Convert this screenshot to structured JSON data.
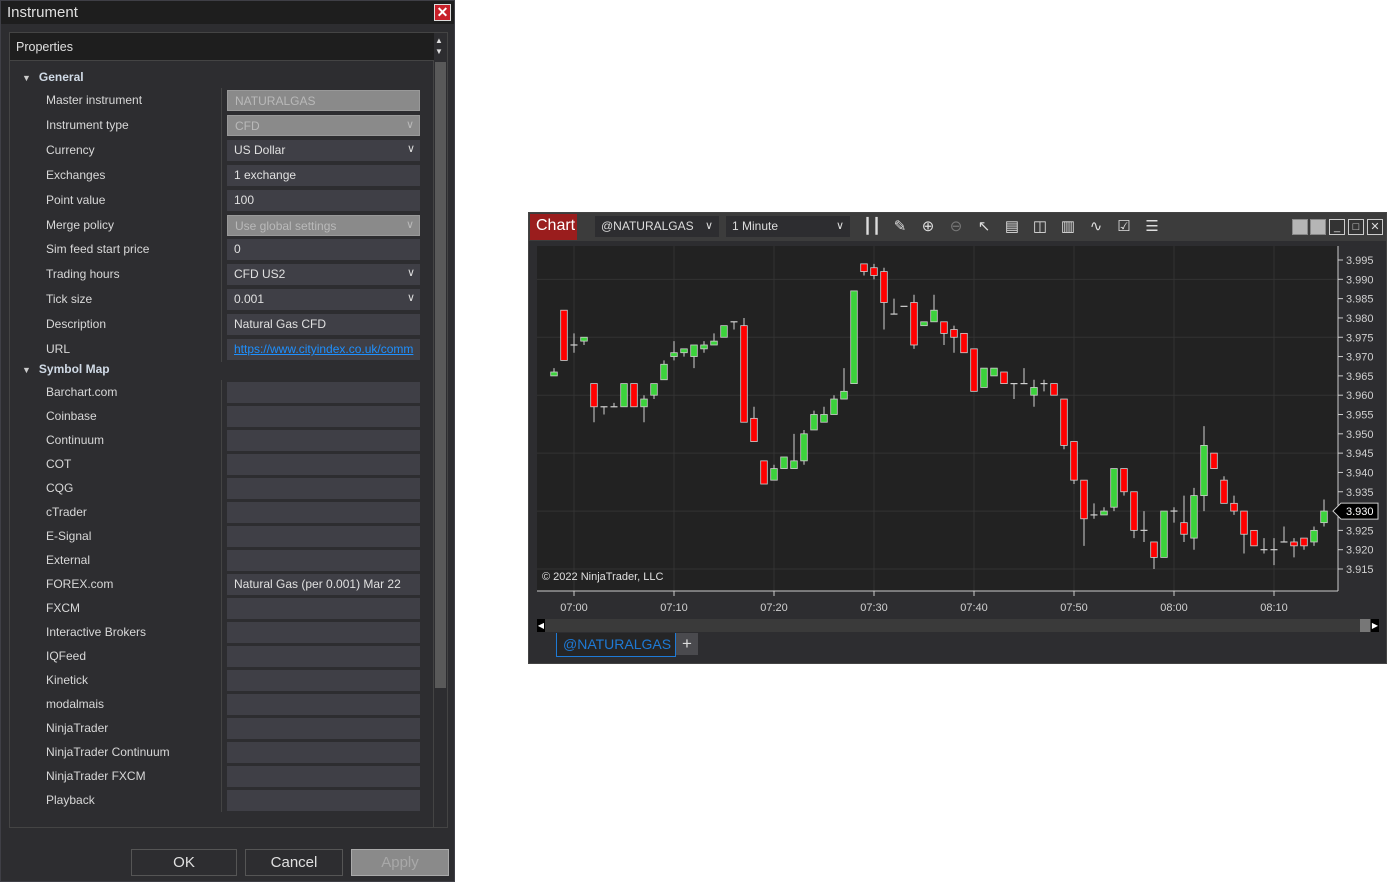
{
  "dialog": {
    "title": "Instrument",
    "properties_header": "Properties",
    "categories": [
      {
        "label": "General",
        "rows": [
          {
            "label": "Master instrument",
            "value": "NATURALGAS",
            "readonly": true,
            "dropdown": false
          },
          {
            "label": "Instrument type",
            "value": "CFD",
            "readonly": true,
            "dropdown": true
          },
          {
            "label": "Currency",
            "value": "US Dollar",
            "readonly": false,
            "dropdown": true
          },
          {
            "label": "Exchanges",
            "value": "1 exchange",
            "readonly": false,
            "dropdown": false
          },
          {
            "label": "Point value",
            "value": "100",
            "readonly": false,
            "dropdown": false
          },
          {
            "label": "Merge policy",
            "value": "Use global settings",
            "readonly": true,
            "dropdown": true
          },
          {
            "label": "Sim feed start price",
            "value": "0",
            "readonly": false,
            "dropdown": false
          },
          {
            "label": "Trading hours",
            "value": "CFD US2",
            "readonly": false,
            "dropdown": true
          },
          {
            "label": "Tick size",
            "value": "0.001",
            "readonly": false,
            "dropdown": true
          },
          {
            "label": "Description",
            "value": "Natural Gas CFD",
            "readonly": false,
            "dropdown": false
          },
          {
            "label": "URL",
            "value": "https://www.cityindex.co.uk/comm",
            "readonly": false,
            "dropdown": false,
            "link": true
          }
        ]
      },
      {
        "label": "Symbol Map",
        "rows": [
          {
            "label": "Barchart.com",
            "value": ""
          },
          {
            "label": "Coinbase",
            "value": ""
          },
          {
            "label": "Continuum",
            "value": ""
          },
          {
            "label": "COT",
            "value": ""
          },
          {
            "label": "CQG",
            "value": ""
          },
          {
            "label": "cTrader",
            "value": ""
          },
          {
            "label": "E-Signal",
            "value": ""
          },
          {
            "label": "External",
            "value": ""
          },
          {
            "label": "FOREX.com",
            "value": "Natural Gas (per 0.001) Mar 22"
          },
          {
            "label": "FXCM",
            "value": ""
          },
          {
            "label": "Interactive Brokers",
            "value": ""
          },
          {
            "label": "IQFeed",
            "value": ""
          },
          {
            "label": "Kinetick",
            "value": ""
          },
          {
            "label": "modalmais",
            "value": ""
          },
          {
            "label": "NinjaTrader",
            "value": ""
          },
          {
            "label": "NinjaTrader Continuum",
            "value": ""
          },
          {
            "label": "NinjaTrader FXCM",
            "value": ""
          },
          {
            "label": "Playback",
            "value": ""
          }
        ]
      }
    ],
    "buttons": {
      "ok": "OK",
      "cancel": "Cancel",
      "apply": "Apply"
    }
  },
  "chart_window": {
    "title": "Chart",
    "instrument": "@NATURALGAS",
    "interval": "1 Minute",
    "toolbar_icons": [
      "bar-type-icon",
      "drawing-tool-icon",
      "zoom-in-icon",
      "zoom-out-icon",
      "pointer-icon",
      "data-box-icon",
      "chart-trader-icon",
      "indicators-icon",
      "strategies-icon",
      "properties-icon",
      "templates-icon"
    ],
    "copyright": "© 2022 NinjaTrader, LLC",
    "tab": "@NATURALGAS",
    "tab_add": "+",
    "colors": {
      "up": "#3cd23c",
      "down": "#ff0000",
      "wick": "#d0d0d0",
      "background": "#222222",
      "accent": "#9a1d1d"
    }
  },
  "chart_data": {
    "type": "candlestick",
    "xlabel": "",
    "ylabel": "",
    "ylim": [
      3.912,
      3.998
    ],
    "yticks": [
      "3.995",
      "3.990",
      "3.985",
      "3.980",
      "3.975",
      "3.970",
      "3.965",
      "3.960",
      "3.955",
      "3.950",
      "3.945",
      "3.940",
      "3.935",
      "3.930",
      "3.925",
      "3.920",
      "3.915"
    ],
    "xticks": [
      "07:00",
      "07:10",
      "07:20",
      "07:30",
      "07:40",
      "07:50",
      "08:00",
      "08:10"
    ],
    "last_price": "3.930",
    "grid": true,
    "columns": [
      "time",
      "open",
      "high",
      "low",
      "close"
    ],
    "candles": [
      [
        "06:58",
        3.965,
        3.967,
        3.965,
        3.966
      ],
      [
        "06:59",
        3.982,
        3.982,
        3.969,
        3.969
      ],
      [
        "07:00",
        3.973,
        3.976,
        3.971,
        3.973
      ],
      [
        "07:01",
        3.974,
        3.975,
        3.973,
        3.975
      ],
      [
        "07:02",
        3.963,
        3.963,
        3.953,
        3.957
      ],
      [
        "07:03",
        3.957,
        3.957,
        3.955,
        3.957
      ],
      [
        "07:04",
        3.957,
        3.958,
        3.957,
        3.957
      ],
      [
        "07:05",
        3.957,
        3.963,
        3.957,
        3.963
      ],
      [
        "07:06",
        3.963,
        3.963,
        3.957,
        3.957
      ],
      [
        "07:07",
        3.957,
        3.96,
        3.953,
        3.959
      ],
      [
        "07:08",
        3.96,
        3.963,
        3.959,
        3.963
      ],
      [
        "07:09",
        3.964,
        3.969,
        3.964,
        3.968
      ],
      [
        "07:10",
        3.97,
        3.974,
        3.969,
        3.971
      ],
      [
        "07:11",
        3.971,
        3.972,
        3.97,
        3.972
      ],
      [
        "07:12",
        3.97,
        3.973,
        3.967,
        3.973
      ],
      [
        "07:13",
        3.972,
        3.974,
        3.971,
        3.973
      ],
      [
        "07:14",
        3.973,
        3.976,
        3.973,
        3.974
      ],
      [
        "07:15",
        3.975,
        3.978,
        3.975,
        3.978
      ],
      [
        "07:16",
        3.979,
        3.979,
        3.977,
        3.979
      ],
      [
        "07:17",
        3.978,
        3.98,
        3.953,
        3.953
      ],
      [
        "07:18",
        3.954,
        3.957,
        3.948,
        3.948
      ],
      [
        "07:19",
        3.943,
        3.943,
        3.937,
        3.937
      ],
      [
        "07:20",
        3.938,
        3.942,
        3.938,
        3.941
      ],
      [
        "07:21",
        3.941,
        3.944,
        3.941,
        3.944
      ],
      [
        "07:22",
        3.941,
        3.95,
        3.941,
        3.943
      ],
      [
        "07:23",
        3.943,
        3.951,
        3.942,
        3.95
      ],
      [
        "07:24",
        3.951,
        3.956,
        3.951,
        3.955
      ],
      [
        "07:25",
        3.953,
        3.957,
        3.953,
        3.955
      ],
      [
        "07:26",
        3.955,
        3.96,
        3.955,
        3.959
      ],
      [
        "07:27",
        3.959,
        3.967,
        3.959,
        3.961
      ],
      [
        "07:28",
        3.963,
        3.987,
        3.963,
        3.987
      ],
      [
        "07:29",
        3.994,
        3.994,
        3.991,
        3.992
      ],
      [
        "07:30",
        3.993,
        3.994,
        3.99,
        3.991
      ],
      [
        "07:31",
        3.992,
        3.993,
        3.977,
        3.984
      ],
      [
        "07:32",
        3.981,
        3.985,
        3.981,
        3.981
      ],
      [
        "07:33",
        3.983,
        3.983,
        3.983,
        3.983
      ],
      [
        "07:34",
        3.984,
        3.986,
        3.972,
        3.973
      ],
      [
        "07:35",
        3.978,
        3.979,
        3.978,
        3.979
      ],
      [
        "07:36",
        3.979,
        3.986,
        3.979,
        3.982
      ],
      [
        "07:37",
        3.979,
        3.979,
        3.973,
        3.976
      ],
      [
        "07:38",
        3.977,
        3.978,
        3.971,
        3.975
      ],
      [
        "07:39",
        3.976,
        3.976,
        3.971,
        3.971
      ],
      [
        "07:40",
        3.972,
        3.972,
        3.961,
        3.961
      ],
      [
        "07:41",
        3.962,
        3.967,
        3.962,
        3.967
      ],
      [
        "07:42",
        3.965,
        3.967,
        3.965,
        3.967
      ],
      [
        "07:43",
        3.966,
        3.966,
        3.963,
        3.963
      ],
      [
        "07:44",
        3.963,
        3.963,
        3.959,
        3.963
      ],
      [
        "07:45",
        3.963,
        3.967,
        3.963,
        3.963
      ],
      [
        "07:46",
        3.96,
        3.964,
        3.957,
        3.962
      ],
      [
        "07:47",
        3.963,
        3.964,
        3.961,
        3.963
      ],
      [
        "07:48",
        3.963,
        3.963,
        3.96,
        3.96
      ],
      [
        "07:49",
        3.959,
        3.959,
        3.946,
        3.947
      ],
      [
        "07:50",
        3.948,
        3.948,
        3.937,
        3.938
      ],
      [
        "07:51",
        3.938,
        3.938,
        3.921,
        3.928
      ],
      [
        "07:52",
        3.929,
        3.932,
        3.928,
        3.929
      ],
      [
        "07:53",
        3.929,
        3.931,
        3.929,
        3.93
      ],
      [
        "07:54",
        3.931,
        3.941,
        3.93,
        3.941
      ],
      [
        "07:55",
        3.941,
        3.941,
        3.934,
        3.935
      ],
      [
        "07:56",
        3.935,
        3.935,
        3.923,
        3.925
      ],
      [
        "07:57",
        3.925,
        3.93,
        3.922,
        3.925
      ],
      [
        "07:58",
        3.922,
        3.922,
        3.915,
        3.918
      ],
      [
        "07:59",
        3.918,
        3.93,
        3.918,
        3.93
      ],
      [
        "08:00",
        3.93,
        3.931,
        3.927,
        3.93
      ],
      [
        "08:01",
        3.927,
        3.934,
        3.922,
        3.924
      ],
      [
        "08:02",
        3.923,
        3.936,
        3.92,
        3.934
      ],
      [
        "08:03",
        3.934,
        3.952,
        3.93,
        3.947
      ],
      [
        "08:04",
        3.945,
        3.945,
        3.941,
        3.941
      ],
      [
        "08:05",
        3.938,
        3.939,
        3.932,
        3.932
      ],
      [
        "08:06",
        3.932,
        3.934,
        3.929,
        3.93
      ],
      [
        "08:07",
        3.93,
        3.93,
        3.919,
        3.924
      ],
      [
        "08:08",
        3.925,
        3.925,
        3.921,
        3.921
      ],
      [
        "08:09",
        3.92,
        3.923,
        3.919,
        3.92
      ],
      [
        "08:10",
        3.92,
        3.923,
        3.916,
        3.92
      ],
      [
        "08:11",
        3.922,
        3.926,
        3.922,
        3.922
      ],
      [
        "08:12",
        3.922,
        3.923,
        3.918,
        3.921
      ],
      [
        "08:13",
        3.923,
        3.923,
        3.92,
        3.921
      ],
      [
        "08:14",
        3.922,
        3.926,
        3.921,
        3.925
      ],
      [
        "08:15",
        3.927,
        3.933,
        3.926,
        3.93
      ]
    ]
  }
}
